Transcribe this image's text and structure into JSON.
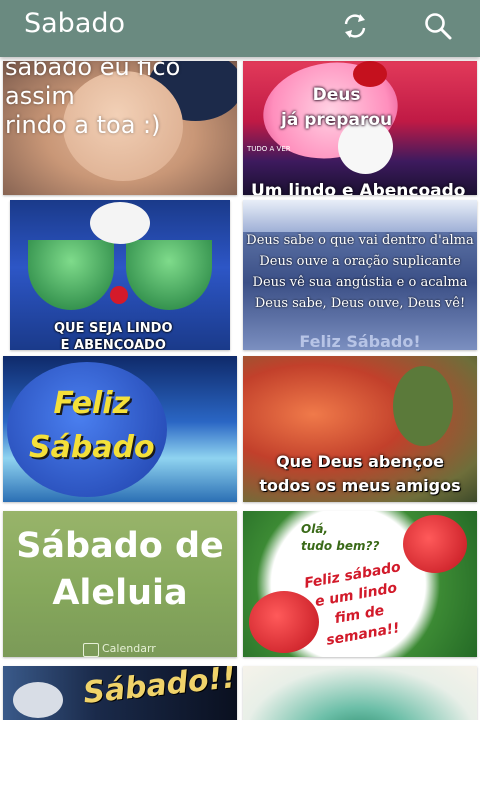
{
  "app": {
    "title": "Sabado",
    "refresh_icon": "refresh-icon",
    "search_icon": "search-icon",
    "accent": "#6a8a80"
  },
  "tiles": [
    {
      "caption": "sabado eu fico\nassim\nrindo a toa :)"
    },
    {
      "caption": "Deus\njá preparou",
      "small": "TUDO A VER",
      "footer": "Um lindo e Abençoado"
    },
    {
      "caption": "QUE SEJA LINDO\nE ABENÇOADO"
    },
    {
      "caption": "Deus sabe o que vai dentro d'alma\nDeus ouve a oração suplicante\nDeus vê sua angústia e o acalma\nDeus sabe, Deus ouve, Deus vê!",
      "footer": "Feliz Sábado!"
    },
    {
      "caption": "Feliz\nSábado"
    },
    {
      "caption": "Que Deus abençoe\ntodos os meus amigos"
    },
    {
      "caption": "Sábado de\nAleluia",
      "small": "Calendarr"
    },
    {
      "caption": "Olá,\ntudo bem??",
      "caption2": "Feliz sábado\ne um lindo\nfim de\nsemana!!"
    },
    {
      "caption": "Sábado!!"
    },
    {
      "caption": ""
    }
  ]
}
